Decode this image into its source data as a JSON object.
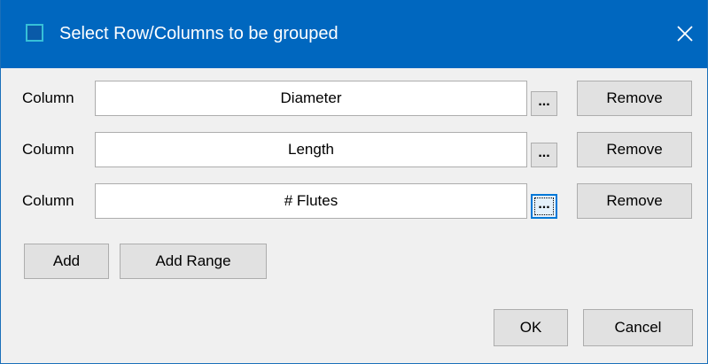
{
  "window": {
    "title": "Select Row/Columns to be grouped",
    "close_icon": "close-icon",
    "app_icon": "window-icon"
  },
  "rows": [
    {
      "label": "Column",
      "value": "Diameter",
      "browse_label": "...",
      "remove_label": "Remove"
    },
    {
      "label": "Column",
      "value": "Length",
      "browse_label": "...",
      "remove_label": "Remove"
    },
    {
      "label": "Column",
      "value": "# Flutes",
      "browse_label": "...",
      "remove_label": "Remove"
    }
  ],
  "actions": {
    "add_label": "Add",
    "add_range_label": "Add Range",
    "ok_label": "OK",
    "cancel_label": "Cancel"
  },
  "colors": {
    "titlebar": "#0067bf",
    "dialog_background": "#f0f0f0",
    "button_face": "#e1e1e1",
    "focus_border": "#0078d7"
  }
}
